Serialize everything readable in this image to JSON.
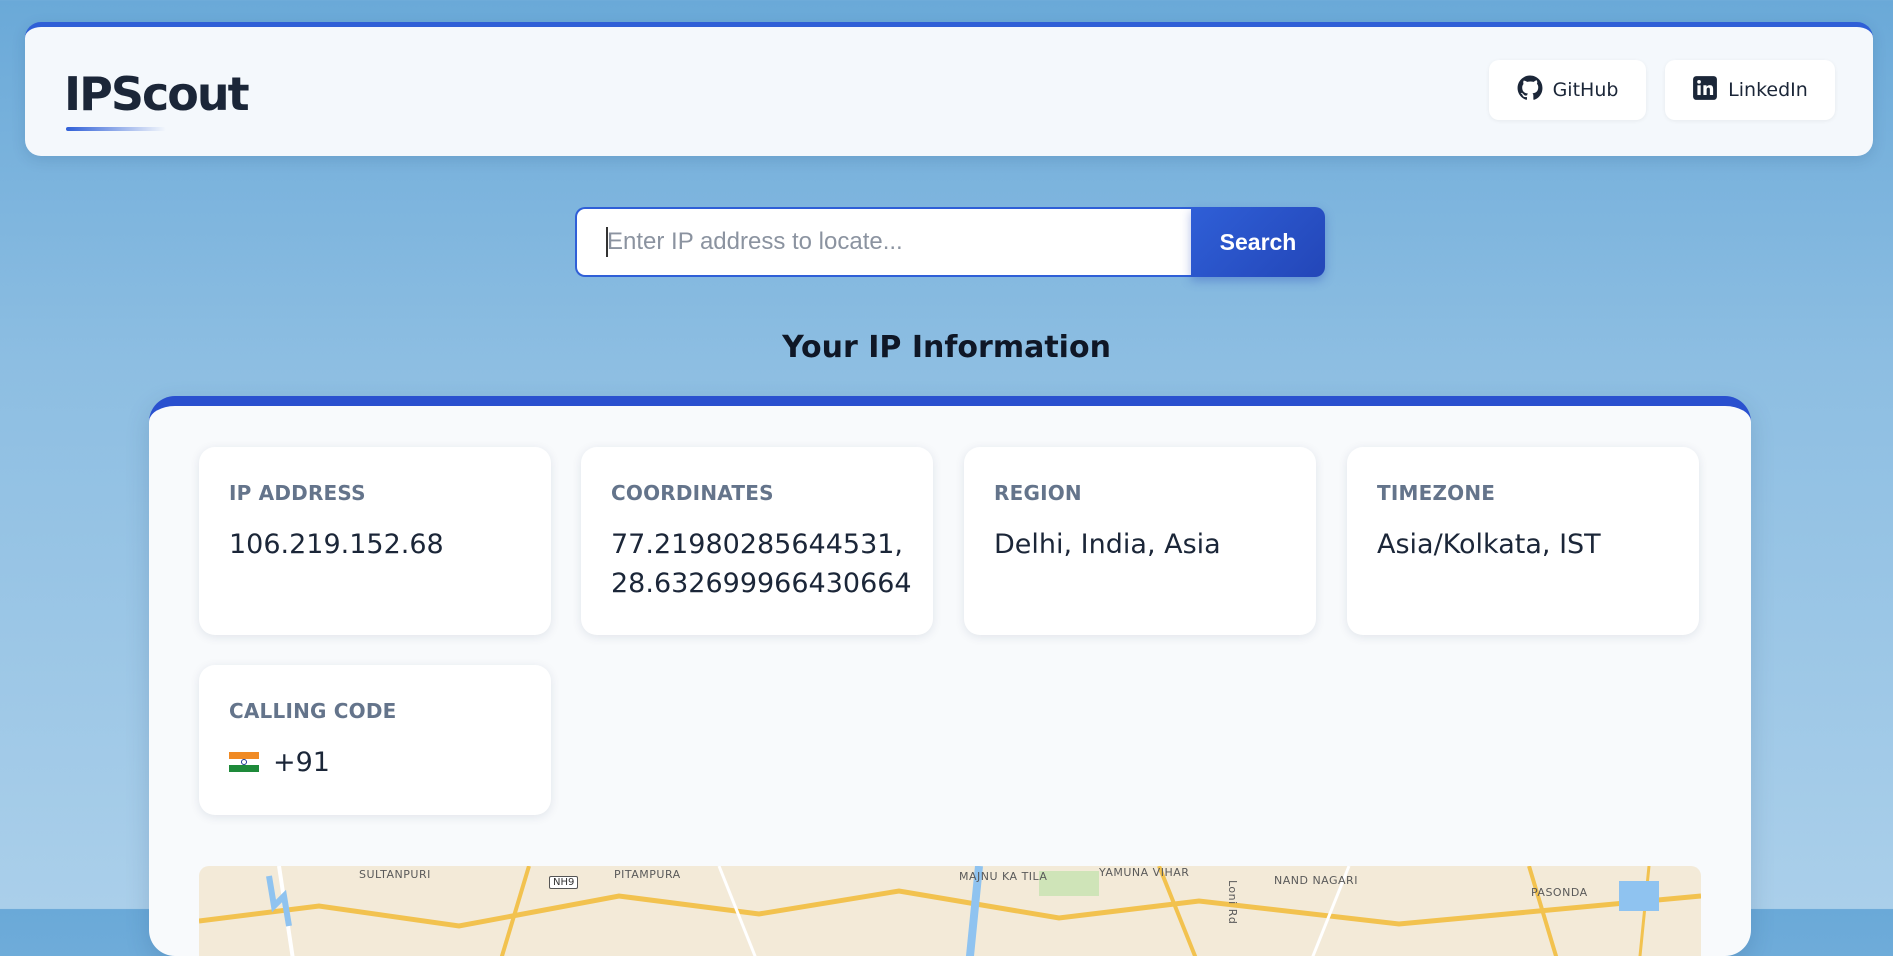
{
  "header": {
    "logo": "IPScout",
    "github_label": "GitHub",
    "linkedin_label": "LinkedIn"
  },
  "search": {
    "placeholder": "Enter IP address to locate...",
    "button_label": "Search"
  },
  "section_title": "Your IP Information",
  "cards": {
    "ip": {
      "label": "IP ADDRESS",
      "value": "106.219.152.68"
    },
    "coordinates": {
      "label": "COORDINATES",
      "value_line1": "77.21980285644531,",
      "value_line2": "28.632699966430664"
    },
    "region": {
      "label": "REGION",
      "value": "Delhi, India, Asia"
    },
    "timezone": {
      "label": "TIMEZONE",
      "value": "Asia/Kolkata, IST"
    },
    "calling_code": {
      "label": "CALLING CODE",
      "value": "+91",
      "flag_icon": "india-flag-icon"
    }
  },
  "map": {
    "labels": [
      "SULTANPURI",
      "PITAMPURA",
      "MAJNU KA TILA",
      "YAMUNA VIHAR",
      "NAND NAGARI",
      "PASONDA",
      "Loni Rd"
    ],
    "highway": "NH9"
  },
  "colors": {
    "accent": "#2f5fd7",
    "accent_dark": "#2346b8",
    "text": "#1b2638",
    "label": "#64748b"
  }
}
